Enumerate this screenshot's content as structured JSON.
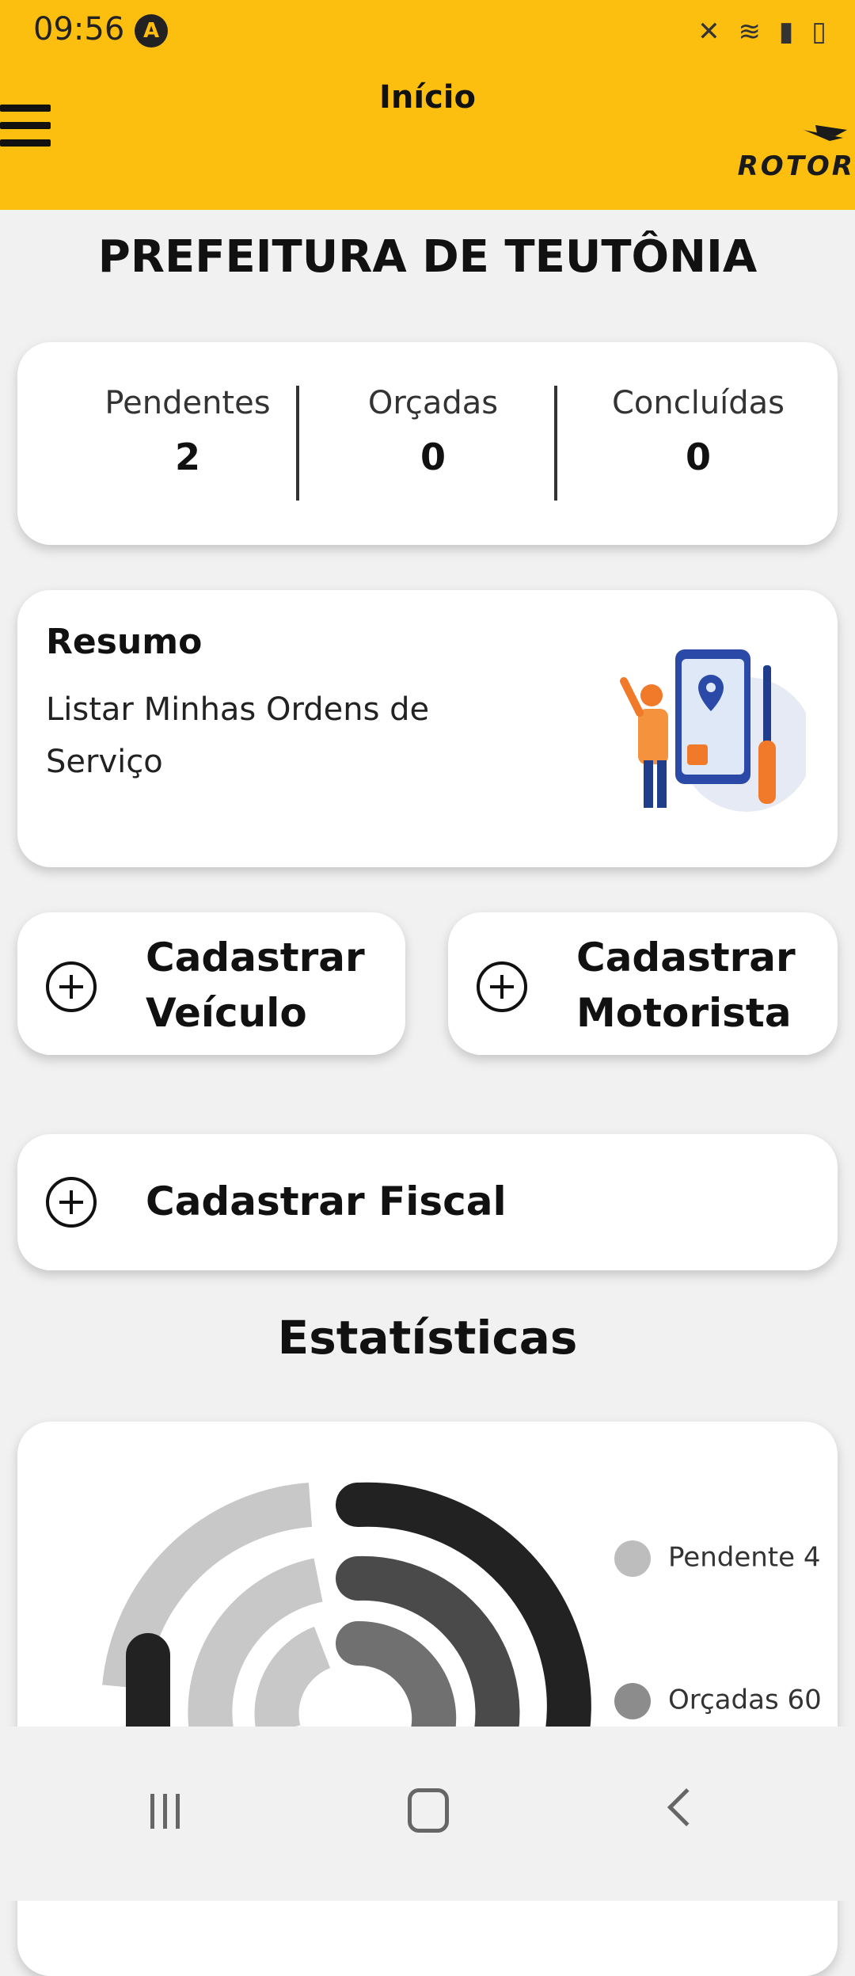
{
  "status_bar": {
    "time": "09:56",
    "notification_glyph": "A",
    "icons": [
      "mute-icon",
      "wifi-icon",
      "signal-icon",
      "battery-icon"
    ]
  },
  "header": {
    "title": "Início",
    "logo_text": "ROTOR",
    "background": "#fdbf0f"
  },
  "organization": "PREFEITURA DE TEUTÔNIA",
  "stats": [
    {
      "label": "Pendentes",
      "value": "2"
    },
    {
      "label": "Orçadas",
      "value": "0"
    },
    {
      "label": "Concluídas",
      "value": "0"
    }
  ],
  "resumo": {
    "title": "Resumo",
    "description": "Listar Minhas Ordens de Serviço"
  },
  "actions": {
    "veiculo": {
      "line1": "Cadastrar",
      "line2": "Veículo"
    },
    "motorista": {
      "line1": "Cadastrar",
      "line2": "Motorista"
    },
    "fiscal": "Cadastrar Fiscal"
  },
  "statistics_title": "Estatísticas",
  "chart_data": {
    "type": "radial-bar",
    "series": [
      {
        "name": "Pendente",
        "legend_text": "Pendente 4",
        "color": "#bdbdbd"
      },
      {
        "name": "Orçadas",
        "legend_text": "Orçadas 60",
        "color": "#8c8c8c"
      }
    ],
    "ring_colors": [
      "#222222",
      "#4a4a4a",
      "#707070"
    ],
    "track_color": "#c8c8c8"
  }
}
